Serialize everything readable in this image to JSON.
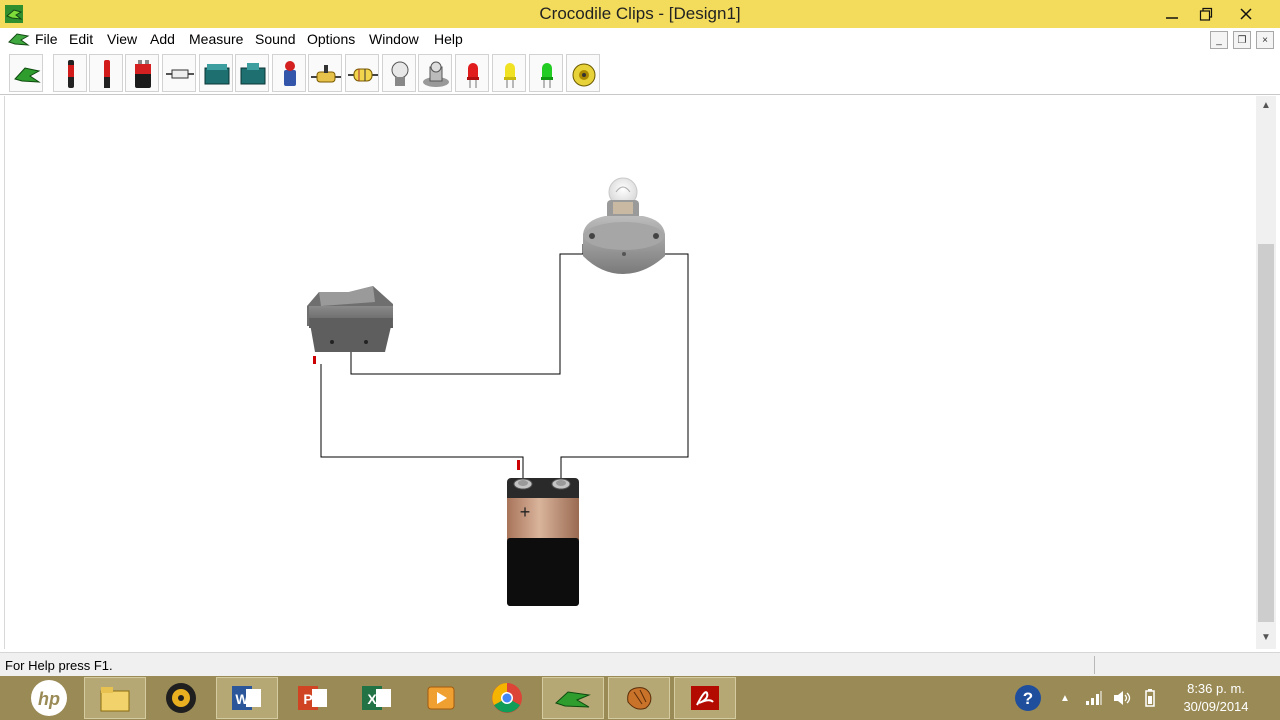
{
  "window": {
    "title": "Crocodile Clips - [Design1]",
    "minimize_glyph": "—",
    "maximize_glyph": "❐",
    "close_glyph": "✕"
  },
  "menu": {
    "items": [
      "File",
      "Edit",
      "View",
      "Add",
      "Measure",
      "Sound",
      "Options",
      "Window",
      "Help"
    ],
    "mdi_buttons": [
      "_",
      "❐",
      "×"
    ]
  },
  "toolbar": {
    "tools": [
      "crocodile-icon",
      "red-probe-icon",
      "black-probe-icon",
      "battery-icon",
      "fuse-icon",
      "switch-icon",
      "push-switch-icon",
      "motor-icon",
      "resistor-icon",
      "variable-resistor-icon",
      "bulb-icon",
      "buzzer-icon",
      "red-led-icon",
      "yellow-led-icon",
      "green-led-icon",
      "speaker-icon"
    ]
  },
  "circuit": {
    "battery_label": "+",
    "components": [
      "rocker-switch",
      "light-bulb",
      "battery"
    ]
  },
  "status": {
    "text": "For Help press F1."
  },
  "taskbar": {
    "apps": [
      "hp",
      "file-explorer",
      "media-player",
      "word",
      "powerpoint",
      "excel",
      "video",
      "chrome",
      "crocodile-clips",
      "game",
      "acrobat"
    ],
    "active_app": "crocodile-clips",
    "clock_time": "8:36 p. m.",
    "clock_date": "30/09/2014",
    "help_glyph": "?",
    "tray_arrow": "▲"
  },
  "colors": {
    "titlebar": "#f3dc5b",
    "taskbar": "#9a8b56",
    "wire": "#000000",
    "terminal": "#cc0000"
  }
}
